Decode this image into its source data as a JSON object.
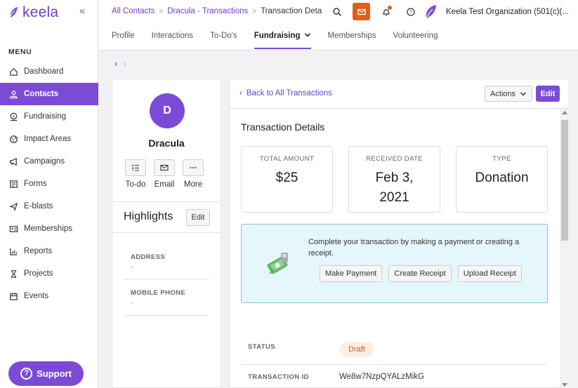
{
  "brand": {
    "name": "keela",
    "accent": "#7b4bd6",
    "orange": "#e25e1c"
  },
  "sidebar": {
    "menu_title": "MENU",
    "items": [
      {
        "label": "Dashboard",
        "icon": "home-icon"
      },
      {
        "label": "Contacts",
        "icon": "person-icon",
        "active": true
      },
      {
        "label": "Fundraising",
        "icon": "dollar-icon"
      },
      {
        "label": "Impact Areas",
        "icon": "globe-icon"
      },
      {
        "label": "Campaigns",
        "icon": "megaphone-icon"
      },
      {
        "label": "Forms",
        "icon": "form-icon"
      },
      {
        "label": "E-blasts",
        "icon": "send-icon"
      },
      {
        "label": "Memberships",
        "icon": "id-card-icon"
      },
      {
        "label": "Reports",
        "icon": "chart-icon"
      },
      {
        "label": "Projects",
        "icon": "hourglass-icon"
      },
      {
        "label": "Events",
        "icon": "calendar-icon"
      }
    ],
    "support_label": "Support"
  },
  "header": {
    "breadcrumb": [
      "All Contacts",
      "Dracula - Transactions",
      "Transaction Deta"
    ],
    "org_name": "Keela Test Organization (501(c)(...",
    "tabs": [
      {
        "label": "Profile"
      },
      {
        "label": "Interactions"
      },
      {
        "label": "To-Do's"
      },
      {
        "label": "Fundraising",
        "active": true,
        "has_dropdown": true
      },
      {
        "label": "Memberships"
      },
      {
        "label": "Volunteering"
      }
    ]
  },
  "contact": {
    "initial": "D",
    "name": "Dracula",
    "actions": [
      {
        "label": "To-do",
        "icon": "checklist-icon"
      },
      {
        "label": "Email",
        "icon": "envelope-icon"
      },
      {
        "label": "More",
        "icon": "more-dots-icon"
      }
    ],
    "highlights_title": "Highlights",
    "edit_label": "Edit",
    "fields": [
      {
        "label": "ADDRESS",
        "value": "-"
      },
      {
        "label": "MOBILE PHONE",
        "value": "-"
      }
    ]
  },
  "transaction": {
    "back_label": "Back to All Transactions",
    "actions_label": "Actions",
    "edit_label": "Edit",
    "title": "Transaction Details",
    "stats": [
      {
        "label": "TOTAL AMOUNT",
        "value": "$25"
      },
      {
        "label": "RECEIVED DATE",
        "value": "Feb 3, 2021"
      },
      {
        "label": "TYPE",
        "value": "Donation"
      }
    ],
    "callout": {
      "text": "Complete your transaction by making a payment or creating a receipt.",
      "buttons": [
        "Make Payment",
        "Create Receipt",
        "Upload Receipt"
      ]
    },
    "status_label": "STATUS",
    "status_value": "Draft",
    "id_label": "TRANSACTION ID",
    "id_value": "We8w7NzpQYALzMikG"
  }
}
